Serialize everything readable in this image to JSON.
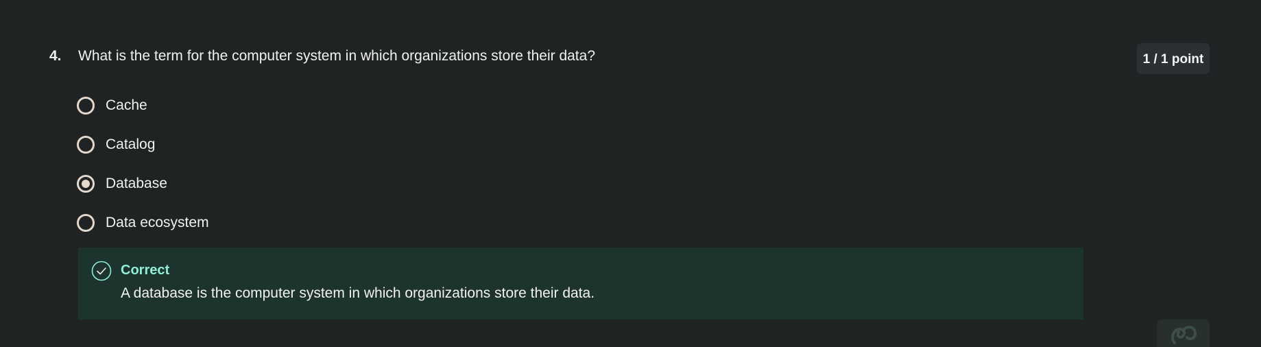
{
  "question": {
    "number": "4.",
    "text": "What is the term for the computer system in which organizations store their data?",
    "points": "1 / 1 point"
  },
  "options": [
    {
      "label": "Cache",
      "selected": false
    },
    {
      "label": "Catalog",
      "selected": false
    },
    {
      "label": "Database",
      "selected": true
    },
    {
      "label": "Data ecosystem",
      "selected": false
    }
  ],
  "feedback": {
    "status": "Correct",
    "message": "A database is the computer system in which organizations store their data.",
    "icon": "check-circle-icon"
  },
  "colors": {
    "background": "#202324",
    "feedback_background": "#1d332d",
    "feedback_accent": "#8ff0d7",
    "radio": "#e3d8cb"
  }
}
